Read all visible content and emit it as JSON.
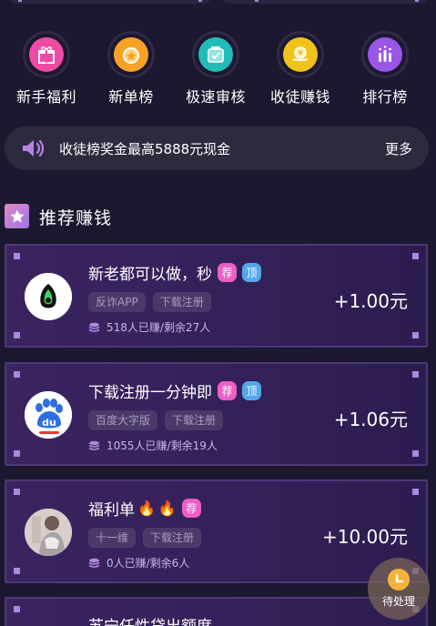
{
  "menu": {
    "items": [
      {
        "label": "新手福利",
        "icon": "gift-icon",
        "color": "#ef4ba4"
      },
      {
        "label": "新单榜",
        "icon": "medal-icon",
        "color": "#f7a226"
      },
      {
        "label": "极速审核",
        "icon": "check-box-icon",
        "color": "#20bdb7"
      },
      {
        "label": "收徒赚钱",
        "icon": "coin-hand-icon",
        "color": "#f1c21b"
      },
      {
        "label": "排行榜",
        "icon": "ranking-icon",
        "color": "#9a56e6"
      }
    ]
  },
  "notice": {
    "text": "收徒榜奖金最高5888元现金",
    "more_label": "更多",
    "icon": "speaker-icon"
  },
  "section": {
    "title": "推荐赚钱",
    "icon": "star-icon"
  },
  "tasks": [
    {
      "title": "新老都可以做，秒",
      "fires": 0,
      "badges": [
        "荐",
        "顶"
      ],
      "tags": [
        "反诈APP",
        "下载注册"
      ],
      "stats": "518人已赚/剩余27人",
      "reward": "+1.00元",
      "avatar": "anti-fraud-app-icon"
    },
    {
      "title": "下载注册一分钟即",
      "fires": 0,
      "badges": [
        "荐",
        "顶"
      ],
      "tags": [
        "百度大字版",
        "下载注册"
      ],
      "stats": "1055人已赚/剩余19人",
      "reward": "+1.06元",
      "avatar": "baidu-icon"
    },
    {
      "title": "福利单",
      "fires": 2,
      "badges": [
        "荐"
      ],
      "tags": [
        "十一维",
        "下载注册"
      ],
      "stats": "0人已赚/剩余6人",
      "reward": "+10.00元",
      "avatar": "user-photo-avatar"
    },
    {
      "title": "苏宁任性贷出额度",
      "partial": true
    }
  ],
  "fab": {
    "label": "待处理",
    "icon": "clock-icon"
  }
}
